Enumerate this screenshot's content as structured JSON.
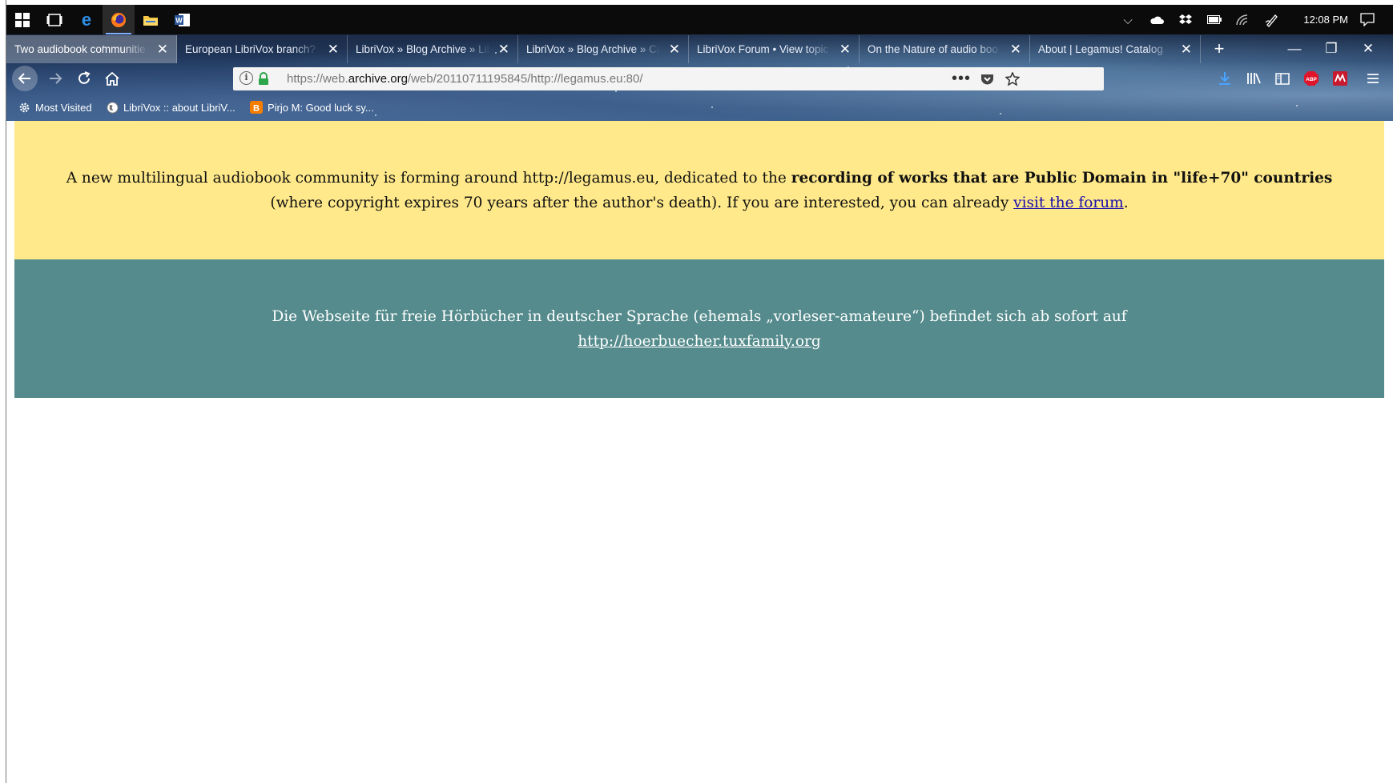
{
  "taskbar": {
    "apps": [
      {
        "name": "start",
        "icon": "windows-logo"
      },
      {
        "name": "task-view",
        "icon": "task-view-icon"
      },
      {
        "name": "edge",
        "icon": "edge-icon"
      },
      {
        "name": "firefox",
        "icon": "firefox-icon"
      },
      {
        "name": "file-explorer",
        "icon": "folder-icon"
      },
      {
        "name": "word",
        "icon": "word-icon"
      }
    ],
    "tray": [
      "chevron-up-icon",
      "onedrive-icon",
      "dropbox-icon",
      "battery-icon",
      "wifi-icon",
      "pen-icon"
    ],
    "clock": "12:08 PM"
  },
  "tabs": [
    {
      "title": "Two audiobook communitie",
      "selected": true
    },
    {
      "title": "European LibriVox branch?",
      "selected": false
    },
    {
      "title": "LibriVox » Blog Archive » Lib",
      "selected": false
    },
    {
      "title": "LibriVox » Blog Archive » Ca",
      "selected": false
    },
    {
      "title": "LibriVox Forum • View topic",
      "selected": false
    },
    {
      "title": "On the Nature of audio boo",
      "selected": false
    },
    {
      "title": "About | Legamus! Catalog",
      "selected": false
    }
  ],
  "tab_close_glyph": "✕",
  "new_tab_glyph": "+",
  "window": {
    "minimize": "—",
    "restore": "❐",
    "close": "✕"
  },
  "url": {
    "prefix": "https://web.",
    "domain": "archive.org",
    "path": "/web/20110711195845/http://legamus.eu:80/"
  },
  "bookmarks": [
    {
      "label": "Most Visited",
      "icon": "gear-icon"
    },
    {
      "label": "LibriVox :: about LibriV...",
      "icon": "globe-icon"
    },
    {
      "label": "Pirjo M: Good luck sy...",
      "icon": "blogger-icon"
    }
  ],
  "page": {
    "yellow": {
      "text1": "A new multilingual audiobook community is forming around http://legamus.eu, dedicated to the ",
      "bold": "recording of works that are Public Domain in \"life+70\" countries",
      "text2": " (where copyright expires 70 years after the author's death). If you are interested, you can already ",
      "link": "visit the forum",
      "text3": "."
    },
    "teal": {
      "text": "Die Webseite für freie Hörbücher in deutscher Sprache (ehemals „vorleser-amateure“) befindet sich ab sofort auf",
      "link": "http://hoerbuecher.tuxfamily.org"
    }
  },
  "colors": {
    "yellow_notice": "#ffe98a",
    "teal_notice": "#558b8c",
    "link": "#1a0dab"
  }
}
